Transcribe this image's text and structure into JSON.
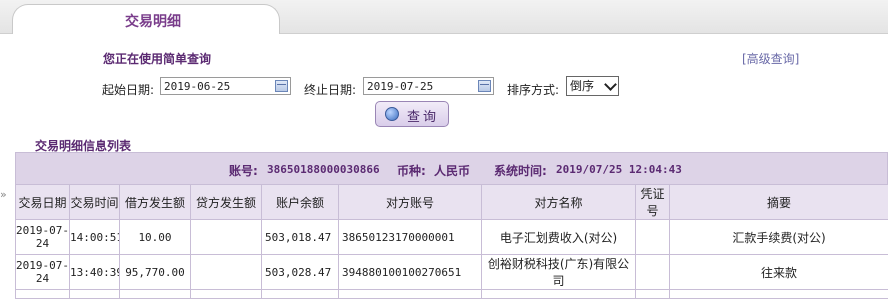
{
  "tab": {
    "label": "交易明细"
  },
  "query": {
    "mode_text": "您正在使用简单查询",
    "advanced_link": "[高级查询]",
    "start_label": "起始日期:",
    "start_date": "2019-06-25",
    "end_label": "终止日期:",
    "end_date": "2019-07-25",
    "sort_label": "排序方式:",
    "sort_value": "倒序",
    "query_button": "查询"
  },
  "list": {
    "section_title": "交易明细信息列表",
    "account_label": "账号:",
    "account_number": "38650188000030866",
    "currency_label": "币种:",
    "currency": "人民币",
    "systime_label": "系统时间:",
    "systime": "2019/07/25 12:04:43"
  },
  "table": {
    "headers": [
      "交易日期",
      "交易时间",
      "借方发生额",
      "贷方发生额",
      "账户余额",
      "对方账号",
      "对方名称",
      "凭证号",
      "摘要"
    ],
    "rows": [
      [
        "2019-07-24",
        "14:00:51",
        "10.00",
        "",
        "503,018.47",
        "38650123170000001",
        "电子汇划费收入(对公)",
        "",
        "汇款手续费(对公)"
      ],
      [
        "2019-07-24",
        "13:40:39",
        "95,770.00",
        "",
        "503,028.47",
        "394880100100270651",
        "创裕财税科技(广东)有限公司",
        "",
        "往来款"
      ]
    ]
  }
}
